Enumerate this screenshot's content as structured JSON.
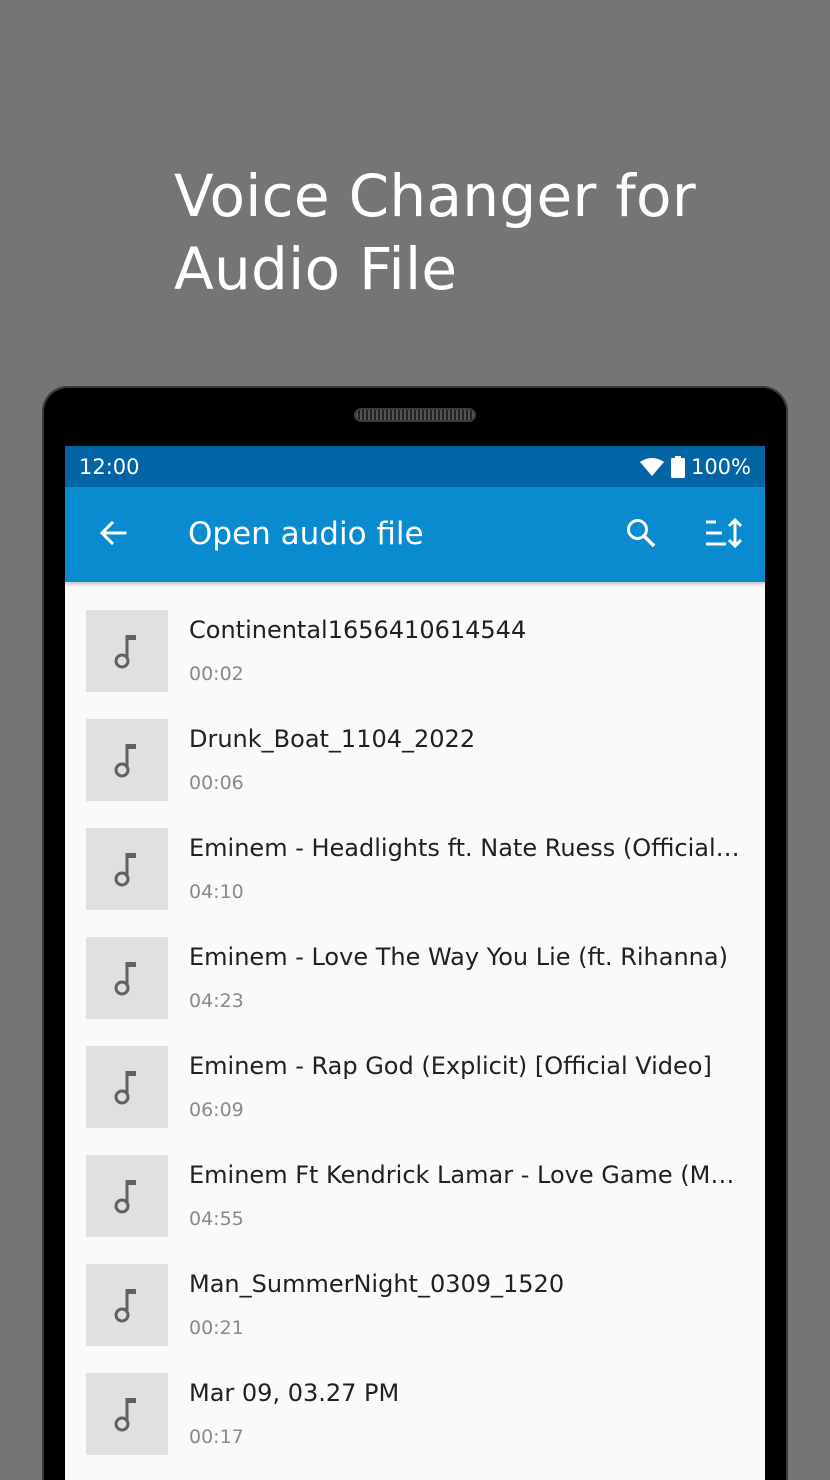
{
  "promo": {
    "title_line1": "Voice Changer for",
    "title_line2": "Audio File"
  },
  "status_bar": {
    "time": "12:00",
    "battery": "100%",
    "icons": [
      "wifi-icon",
      "battery-icon"
    ]
  },
  "app_bar": {
    "title": "Open audio file",
    "back_icon": "arrow-back-icon",
    "search_icon": "search-icon",
    "sort_icon": "sort-icon"
  },
  "colors": {
    "status_bar": "#0465a6",
    "app_bar": "#0a8bcf",
    "background": "#757575",
    "thumb": "#e0e0e0"
  },
  "files": [
    {
      "name": "Continental1656410614544",
      "duration": "00:02"
    },
    {
      "name": "Drunk_Boat_1104_2022",
      "duration": "00:06"
    },
    {
      "name": "Eminem - Headlights ft. Nate Ruess (Official …",
      "duration": "04:10"
    },
    {
      "name": "Eminem - Love The Way You Lie (ft. Rihanna)",
      "duration": "04:23"
    },
    {
      "name": "Eminem - Rap God (Explicit) [Official Video]",
      "duration": "06:09"
    },
    {
      "name": "Eminem Ft Kendrick Lamar -  Love Game (M…",
      "duration": "04:55"
    },
    {
      "name": "Man_SummerNight_0309_1520",
      "duration": "00:21"
    },
    {
      "name": "Mar 09, 03.27 PM",
      "duration": "00:17"
    }
  ]
}
